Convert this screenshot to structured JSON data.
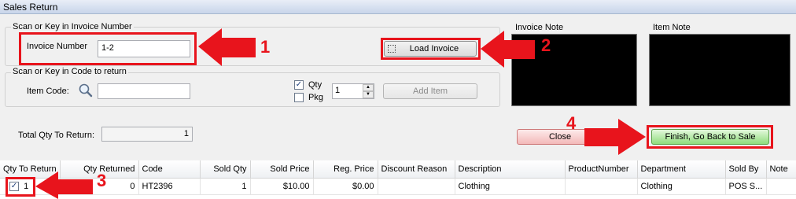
{
  "window": {
    "title": "Sales Return"
  },
  "invoice_group": {
    "title": "Scan or Key in Invoice Number",
    "invoice_number_label": "Invoice Number",
    "invoice_number_value": "1-2",
    "load_invoice_label": "Load Invoice"
  },
  "item_group": {
    "title": "Scan or Key in Code to return",
    "item_code_label": "Item Code:",
    "item_code_value": "",
    "qty_label": "Qty",
    "pkg_label": "Pkg",
    "qty_checked": true,
    "pkg_checked": false,
    "quantity_value": "1",
    "add_item_label": "Add Item"
  },
  "notes": {
    "invoice_note_label": "Invoice Note",
    "item_note_label": "Item Note"
  },
  "totals": {
    "total_qty_label": "Total Qty To Return:",
    "total_qty_value": "1"
  },
  "actions": {
    "close_label": "Close",
    "finish_label": "Finish, Go Back to Sale"
  },
  "grid": {
    "columns": [
      "Qty To Return",
      "Qty Returned",
      "Code",
      "Sold Qty",
      "Sold Price",
      "Reg. Price",
      "Discount Reason",
      "Description",
      "ProductNumber",
      "Department",
      "Sold By",
      "Note"
    ],
    "rows": [
      {
        "qty_to_return": "1",
        "qty_returned": "0",
        "code": "HT2396",
        "sold_qty": "1",
        "sold_price": "$10.00",
        "reg_price": "$0.00",
        "discount_reason": "",
        "description": "Clothing",
        "product_number": "",
        "department": "Clothing",
        "sold_by": "POS S...",
        "note": ""
      }
    ]
  },
  "annotations": {
    "callout_1": "1",
    "callout_2": "2",
    "callout_3": "3",
    "callout_4": "4",
    "accent_color": "#e8141c"
  }
}
